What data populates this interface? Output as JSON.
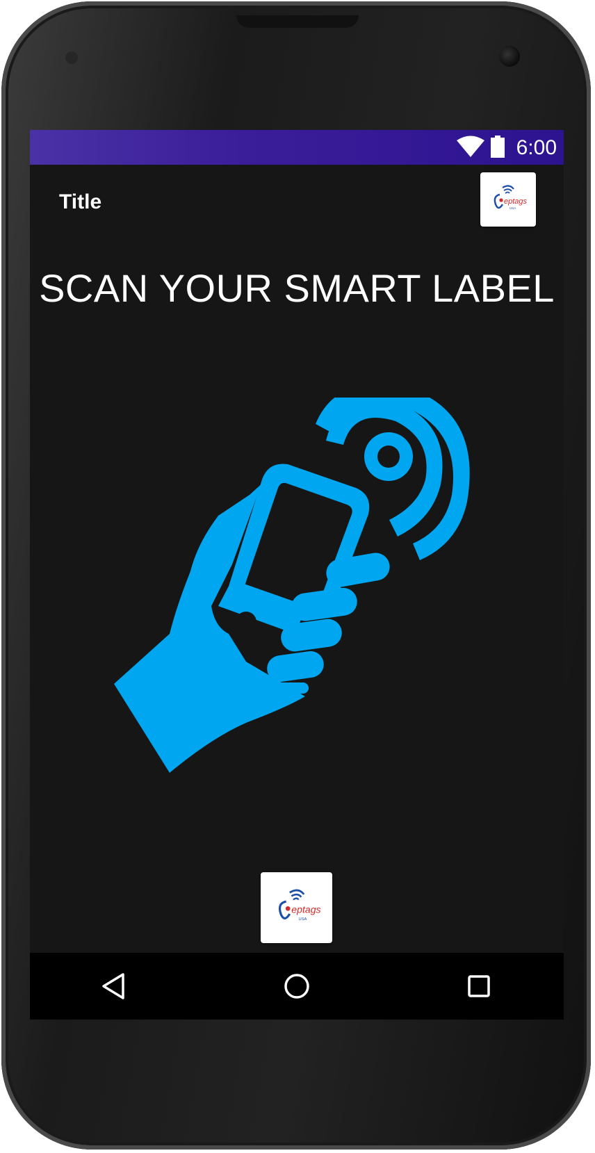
{
  "status_bar": {
    "time": "6:00",
    "wifi_icon": "wifi-full-icon",
    "battery_icon": "battery-full-icon",
    "color_start": "#4a32a6",
    "color_end": "#2d1390"
  },
  "app_bar": {
    "title": "Title",
    "logo_text": "eptags",
    "logo_subtext": "USA"
  },
  "main": {
    "headline": "SCAN YOUR SMART LABEL",
    "illustration_icon": "hand-holding-phone-nfc-icon",
    "accent_color": "#00a6ef"
  },
  "footer": {
    "logo_text": "eptags",
    "logo_subtext": "USA"
  },
  "nav_bar": {
    "back_icon": "back-triangle-icon",
    "home_icon": "home-circle-icon",
    "recents_icon": "recents-square-icon"
  }
}
